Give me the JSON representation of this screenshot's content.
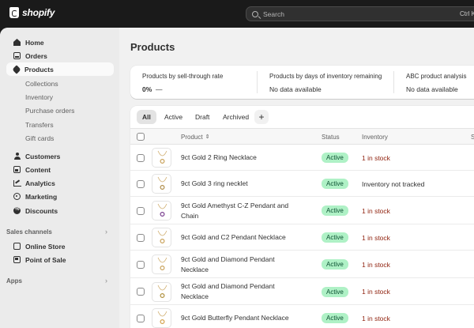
{
  "app": {
    "logo_text": "shopify"
  },
  "search": {
    "placeholder": "Search",
    "shortcut": "Ctrl K"
  },
  "sidebar": {
    "items": [
      {
        "label": "Home",
        "icon": "home-icon"
      },
      {
        "label": "Orders",
        "icon": "orders-icon"
      },
      {
        "label": "Products",
        "icon": "tag-icon",
        "active": true
      }
    ],
    "product_subitems": [
      "Collections",
      "Inventory",
      "Purchase orders",
      "Transfers",
      "Gift cards"
    ],
    "items2": [
      {
        "label": "Customers",
        "icon": "person-icon"
      },
      {
        "label": "Content",
        "icon": "content-icon"
      },
      {
        "label": "Analytics",
        "icon": "analytics-icon"
      },
      {
        "label": "Marketing",
        "icon": "marketing-icon"
      },
      {
        "label": "Discounts",
        "icon": "discount-icon"
      }
    ],
    "sales_channels_label": "Sales channels",
    "sales_channels": [
      {
        "label": "Online Store",
        "icon": "online-store-icon"
      },
      {
        "label": "Point of Sale",
        "icon": "pos-icon"
      }
    ],
    "apps_label": "Apps"
  },
  "main": {
    "title": "Products",
    "metrics": [
      {
        "label": "Products by sell-through rate",
        "value": "0%",
        "suffix": "—"
      },
      {
        "label": "Products by days of inventory remaining",
        "value": "No data available"
      },
      {
        "label": "ABC product analysis",
        "value": "No data available"
      }
    ],
    "tabs": [
      "All",
      "Active",
      "Draft",
      "Archived"
    ],
    "add_tab": "+",
    "columns": {
      "product": "Product",
      "status": "Status",
      "inventory": "Inventory",
      "extra": "S"
    },
    "rows": [
      {
        "name_1": "9ct Gold 2 Ring Necklace",
        "name_2": "",
        "status": "Active",
        "inventory": "1 in stock",
        "inv_color": "red"
      },
      {
        "name_1": "9ct Gold 3 ring necklet",
        "name_2": "",
        "status": "Active",
        "inventory": "Inventory not tracked",
        "inv_color": "gray"
      },
      {
        "name_1": "9ct Gold Amethyst C-Z Pendant and",
        "name_2": "Chain",
        "status": "Active",
        "inventory": "1 in stock",
        "inv_color": "red"
      },
      {
        "name_1": "9ct Gold and C2 Pendant Necklace",
        "name_2": "",
        "status": "Active",
        "inventory": "1 in stock",
        "inv_color": "red"
      },
      {
        "name_1": "9ct Gold and Diamond Pendant",
        "name_2": "Necklace",
        "status": "Active",
        "inventory": "1 in stock",
        "inv_color": "red"
      },
      {
        "name_1": "9ct Gold and Diamond Pendant",
        "name_2": "Necklace",
        "status": "Active",
        "inventory": "1 in stock",
        "inv_color": "red"
      },
      {
        "name_1": "9ct Gold Butterfly Pendant Necklace",
        "name_2": "",
        "status": "Active",
        "inventory": "1 in stock",
        "inv_color": "red"
      }
    ]
  },
  "colors": {
    "topbar": "#1a1a1a",
    "active_badge_bg": "#aff1c6",
    "stock_red": "#8e1f0b"
  }
}
